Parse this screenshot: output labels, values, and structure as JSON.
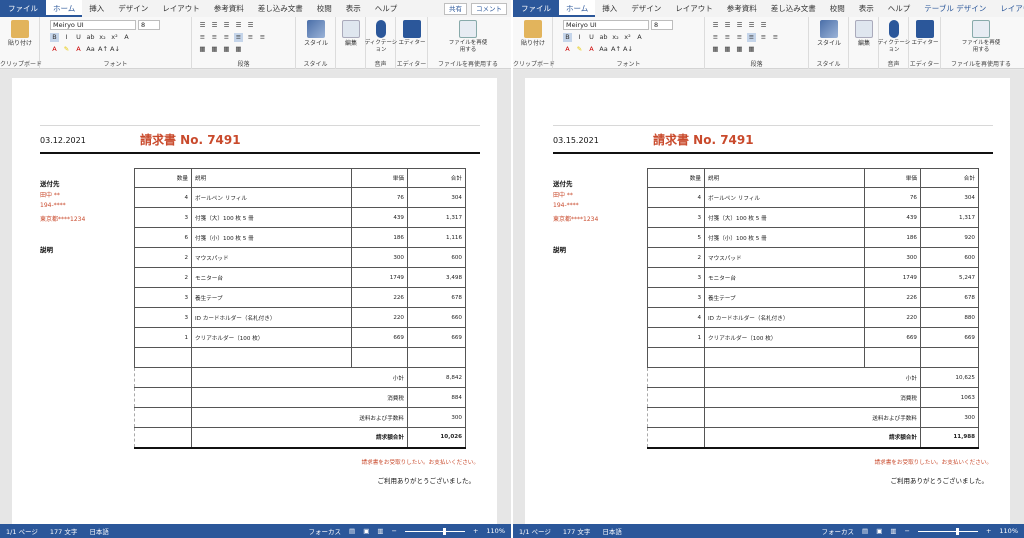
{
  "colors": {
    "ribbon_blue": "#2b579a",
    "accent_red": "#c94a2c"
  },
  "windows": [
    {
      "tabs": [
        "ファイル",
        "ホーム",
        "挿入",
        "デザイン",
        "レイアウト",
        "参考資料",
        "差し込み文書",
        "校閲",
        "表示",
        "ヘルプ"
      ],
      "share_label": "共有",
      "comment_label": "コメント",
      "ribbon": {
        "paste_label": "貼り付け",
        "clipboard_label": "クリップボード",
        "font_name": "Meiryo UI",
        "font_size": "8",
        "font_label": "フォント",
        "paragraph_label": "段落",
        "style_label": "スタイル",
        "style_group_label": "スタイル",
        "edit_label": "編集",
        "dictation_label": "ディクテーション",
        "voice_label": "音声",
        "editor_label": "エディター",
        "editor_group_label": "エディター",
        "reuse_label": "ファイルを再使用する",
        "reuse_group_label": "ファイルを再使用する"
      },
      "doc": {
        "date": "03.12.2021",
        "title": "請求書 No. 7491",
        "to_label": "送付先",
        "name": "田中 **",
        "zip": "194-****",
        "address": "東京都****1234",
        "desc_label": "説明",
        "headers": [
          "数量",
          "説明",
          "単価",
          "合計"
        ],
        "rows": [
          [
            "4",
            "ボールペン リフィル",
            "76",
            "304"
          ],
          [
            "3",
            "付箋（大）100 枚 5 冊",
            "439",
            "1,317"
          ],
          [
            "6",
            "付箋（小）100 枚 5 冊",
            "186",
            "1,116"
          ],
          [
            "2",
            "マウスパッド",
            "300",
            "600"
          ],
          [
            "2",
            "モニター台",
            "1749",
            "3,498"
          ],
          [
            "3",
            "養生テープ",
            "226",
            "678"
          ],
          [
            "3",
            "ID カードホルダー（名札付き）",
            "220",
            "660"
          ],
          [
            "1",
            "クリアホルダー（100 枚）",
            "669",
            "669"
          ]
        ],
        "subtotal_label": "小計",
        "subtotal": "8,842",
        "tax_label": "消費税",
        "tax": "884",
        "shipping_label": "送料および手数料",
        "shipping": "300",
        "grand_label": "請求額合計",
        "grand": "10,026",
        "note": "請求書をお受取りしたい。お支払いください。",
        "thanks": "ご利用ありがとうございました。"
      },
      "status": {
        "page": "1/1 ページ",
        "words": "177 文字",
        "lang": "日本語",
        "focus": "フォーカス",
        "zoom": "110%"
      }
    },
    {
      "tabs": [
        "ファイル",
        "ホーム",
        "挿入",
        "デザイン",
        "レイアウト",
        "参考資料",
        "差し込み文書",
        "校閲",
        "表示",
        "ヘルプ",
        "テーブル デザイン",
        "レイアウト"
      ],
      "share_label": "",
      "comment_label": "",
      "ribbon": {
        "paste_label": "貼り付け",
        "clipboard_label": "クリップボード",
        "font_name": "Meiryo UI",
        "font_size": "8",
        "font_label": "フォント",
        "paragraph_label": "段落",
        "style_label": "スタイル",
        "style_group_label": "スタイル",
        "edit_label": "編集",
        "dictation_label": "ディクテーション",
        "voice_label": "音声",
        "editor_label": "エディター",
        "editor_group_label": "エディター",
        "reuse_label": "ファイルを再使用する",
        "reuse_group_label": "ファイルを再使用する"
      },
      "doc": {
        "date": "03.15.2021",
        "title": "請求書 No. 7491",
        "to_label": "送付先",
        "name": "田中 **",
        "zip": "194-****",
        "address": "東京都****1234",
        "desc_label": "説明",
        "headers": [
          "数量",
          "説明",
          "単価",
          "合計"
        ],
        "rows": [
          [
            "4",
            "ボールペン リフィル",
            "76",
            "304"
          ],
          [
            "3",
            "付箋（大）100 枚 5 冊",
            "439",
            "1,317"
          ],
          [
            "5",
            "付箋（小）100 枚 5 冊",
            "186",
            "920"
          ],
          [
            "2",
            "マウスパッド",
            "300",
            "600"
          ],
          [
            "3",
            "モニター台",
            "1749",
            "5,247"
          ],
          [
            "3",
            "養生テープ",
            "226",
            "678"
          ],
          [
            "4",
            "ID カードホルダー（名札付き）",
            "220",
            "880"
          ],
          [
            "1",
            "クリアホルダー（100 枚）",
            "669",
            "669"
          ]
        ],
        "subtotal_label": "小計",
        "subtotal": "10,625",
        "tax_label": "消費税",
        "tax": "1063",
        "shipping_label": "送料および手数料",
        "shipping": "300",
        "grand_label": "請求額合計",
        "grand": "11,988",
        "note": "請求書をお受取りしたい。お支払いください。",
        "thanks": "ご利用ありがとうございました。"
      },
      "status": {
        "page": "1/1 ページ",
        "words": "177 文字",
        "lang": "日本語",
        "focus": "フォーカス",
        "zoom": "110%"
      }
    }
  ]
}
